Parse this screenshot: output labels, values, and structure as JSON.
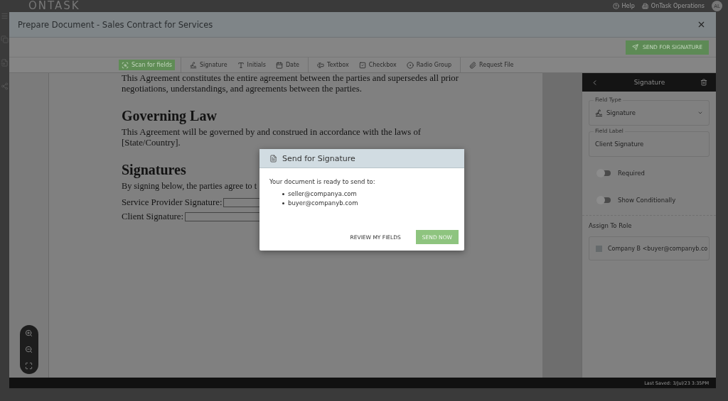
{
  "topbar": {
    "logo": "ONTASK",
    "help": "Help",
    "org": "OnTask Operations",
    "avatar": "AL"
  },
  "window": {
    "title": "Prepare Document - Sales Contract for Services",
    "send_button": "SEND FOR SIGNATURE"
  },
  "toolbar_groups": [
    [
      {
        "label": "Scan for fields",
        "selected": true
      }
    ],
    [
      {
        "label": "Signature",
        "selected": false
      },
      {
        "label": "Initials",
        "selected": false
      },
      {
        "label": "Date",
        "selected": false
      }
    ],
    [
      {
        "label": "Textbox",
        "selected": false
      },
      {
        "label": "Checkbox",
        "selected": false
      },
      {
        "label": "Radio Group",
        "selected": false
      }
    ],
    [
      {
        "label": "Request File",
        "selected": false
      }
    ]
  ],
  "document": [
    {
      "kind": "paragraph",
      "text": "This Agreement constitutes the entire agreement between the parties and supersedes all prior negotiations, understandings, and agreements between the parties."
    },
    {
      "kind": "heading",
      "text": "Governing Law"
    },
    {
      "kind": "paragraph",
      "text": "This Agreement will be governed by and construed in accordance with the laws of [State/Country]."
    },
    {
      "kind": "heading",
      "text": "Signatures"
    },
    {
      "kind": "paragraph",
      "text": "By signing below, the parties agree to t"
    },
    {
      "kind": "field",
      "text": "Service Provider Signature:"
    },
    {
      "kind": "field",
      "text": "Client Signature:"
    }
  ],
  "panel": {
    "title": "Signature",
    "field_type": {
      "label": "Field Type",
      "value": "Signature"
    },
    "field_label": {
      "label": "Field Label",
      "value": "Client Signature"
    },
    "toggles": [
      {
        "label": "Required",
        "on": false
      },
      {
        "label": "Show Conditionally",
        "on": false
      }
    ],
    "assign_title": "Assign To Role",
    "roles": [
      {
        "label": "Company B <buyer@companyb.co",
        "checked": false
      }
    ]
  },
  "status_bar": "Last Saved: 3/Jul/23 3:35PM",
  "modal": {
    "title": "Send for Signature",
    "message": "Your document is ready to send to:",
    "recipients": [
      "seller@companya.com",
      "buyer@companyb.com"
    ],
    "buttons": [
      {
        "label": "REVIEW MY FIELDS",
        "kind": "text"
      },
      {
        "label": "SEND NOW",
        "kind": "primary"
      }
    ]
  }
}
